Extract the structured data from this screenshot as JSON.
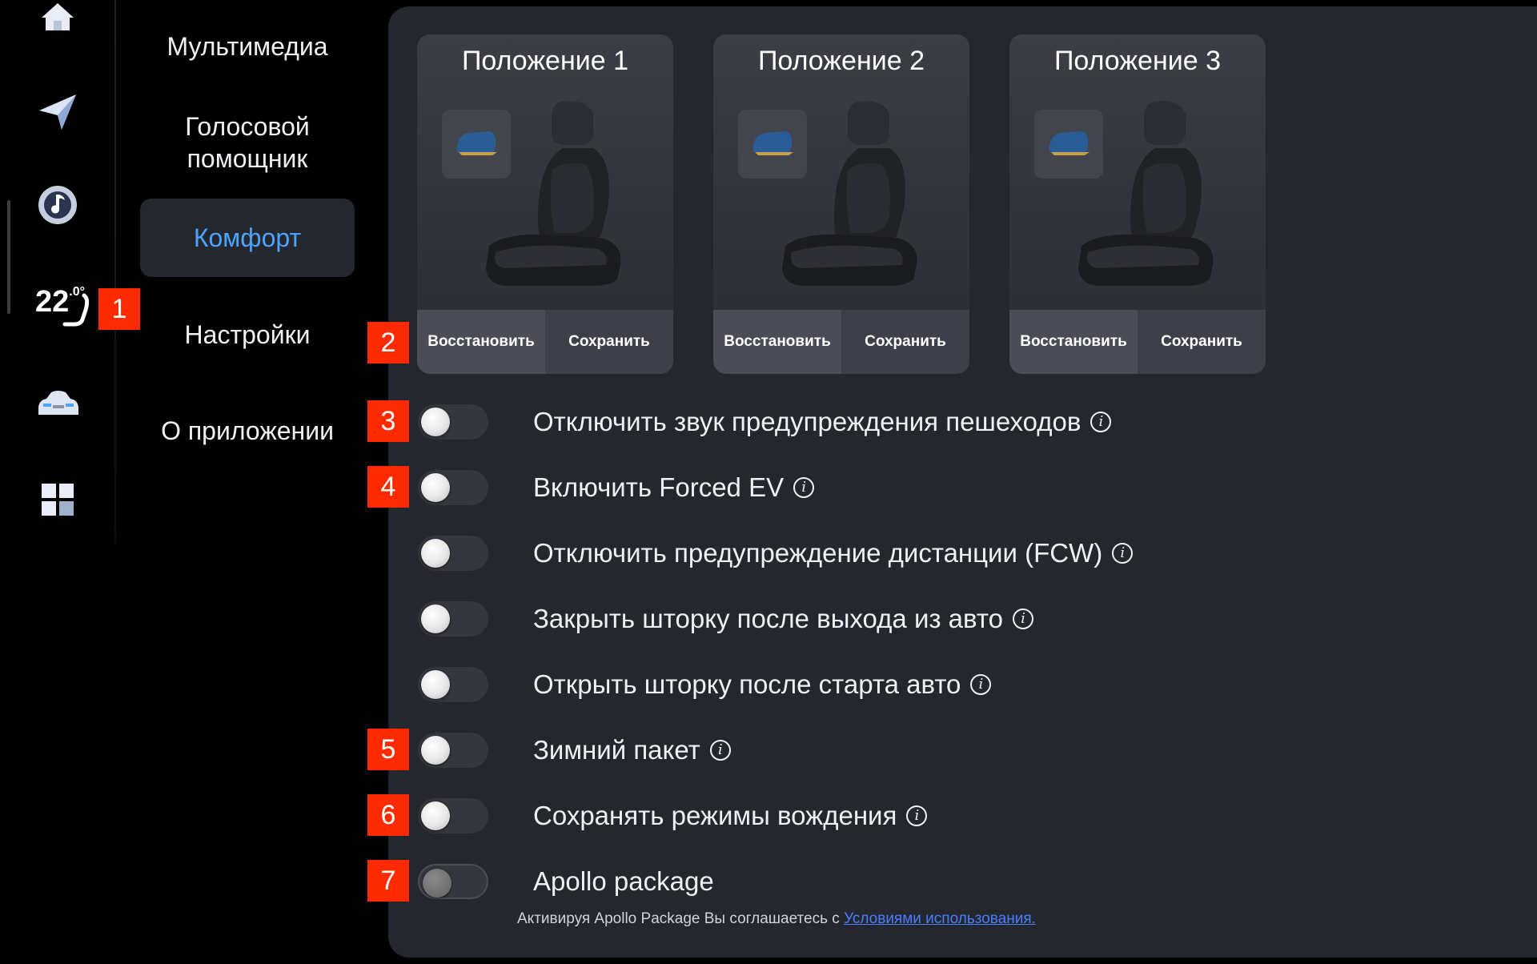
{
  "rail": {
    "temperature": "22",
    "temperature_unit": ".0°"
  },
  "menu": {
    "items": [
      {
        "label": "Мультимедиа"
      },
      {
        "label": "Голосовой помощник"
      },
      {
        "label": "Комфорт"
      },
      {
        "label": "Настройки"
      },
      {
        "label": "О приложении"
      }
    ],
    "active_index": 2
  },
  "seat_positions": [
    {
      "title": "Положение 1",
      "restore_label": "Восстановить",
      "save_label": "Сохранить"
    },
    {
      "title": "Положение 2",
      "restore_label": "Восстановить",
      "save_label": "Сохранить"
    },
    {
      "title": "Положение 3",
      "restore_label": "Восстановить",
      "save_label": "Сохранить"
    }
  ],
  "toggles": [
    {
      "label": "Отключить звук предупреждения пешеходов",
      "on": false,
      "info": true
    },
    {
      "label": "Включить Forced EV",
      "on": false,
      "info": true
    },
    {
      "label": "Отключить предупреждение дистанции (FCW)",
      "on": false,
      "info": true
    },
    {
      "label": "Закрыть шторку после выхода из авто",
      "on": false,
      "info": true
    },
    {
      "label": "Открыть шторку после старта авто",
      "on": false,
      "info": true
    },
    {
      "label": "Зимний пакет",
      "on": false,
      "info": true
    },
    {
      "label": "Сохранять режимы вождения",
      "on": false,
      "info": true
    },
    {
      "label": "Apollo package",
      "on": false,
      "info": false
    }
  ],
  "info_glyph": "i",
  "apollo_note": {
    "text": "Активируя Apollo Package Вы соглашаетесь с ",
    "link": "Условиями использования."
  },
  "badges": [
    "1",
    "2",
    "3",
    "4",
    "5",
    "6",
    "7"
  ],
  "colors": {
    "accent": "#4ea3ff",
    "panel": "#24272e",
    "badge": "#ff2a00",
    "link": "#4a7dff"
  }
}
